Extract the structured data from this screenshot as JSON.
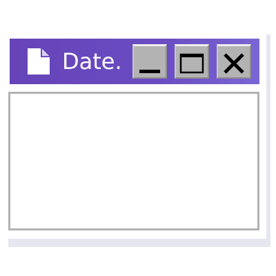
{
  "window": {
    "title": "Date.",
    "title_icon": "document-icon",
    "buttons": {
      "minimize_icon": "minimize-icon",
      "maximize_icon": "maximize-icon",
      "close_icon": "close-icon"
    }
  },
  "colors": {
    "title_bar_start": "#6644b8",
    "title_bar_end": "#7a66d4",
    "button_face": "#b3b3b3",
    "content_border": "#b2b2b2",
    "shadow": "#e6e6f0"
  }
}
